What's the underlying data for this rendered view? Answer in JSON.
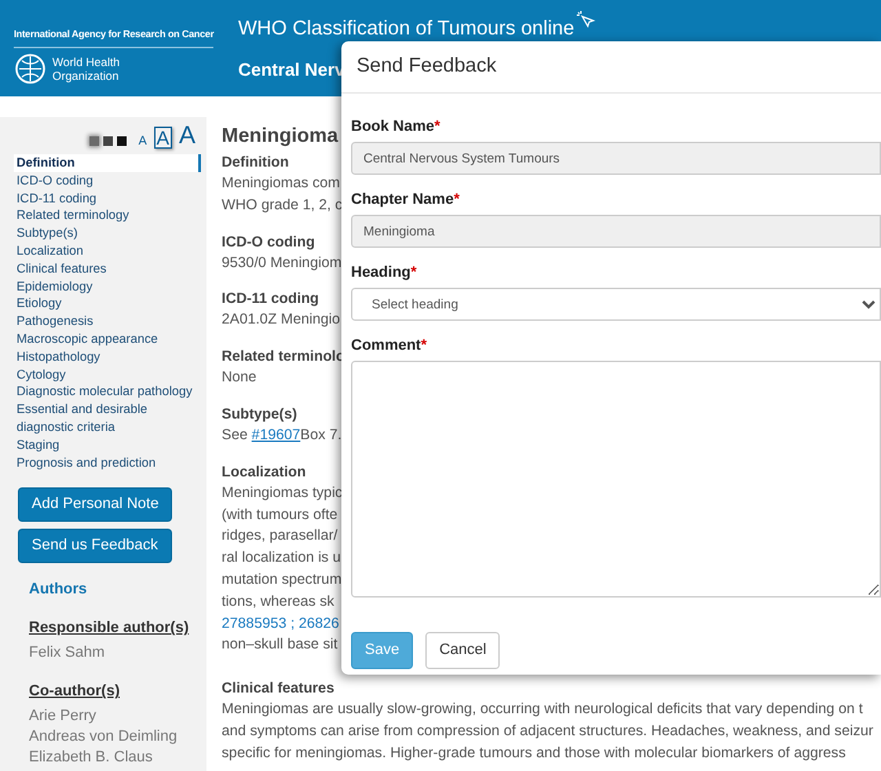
{
  "header": {
    "org_line": "International Agency for Research on Cancer",
    "who_lines": [
      "World Health",
      "Organization"
    ],
    "title": "WHO Classification of Tumours online",
    "subtitle": "Central Nerv"
  },
  "sidebar": {
    "swatches": [
      {
        "color": "#6b6b6b",
        "selected": true
      },
      {
        "color": "#444444",
        "selected": false
      },
      {
        "color": "#111111",
        "selected": false
      }
    ],
    "font_sizes": [
      {
        "label": "A",
        "selected": false
      },
      {
        "label": "A",
        "selected": true
      },
      {
        "label": "A",
        "selected": false
      }
    ],
    "nav": [
      {
        "label": "Definition",
        "selected": true
      },
      {
        "label": "ICD-O coding",
        "selected": false
      },
      {
        "label": "ICD-11 coding",
        "selected": false
      },
      {
        "label": "Related terminology",
        "selected": false
      },
      {
        "label": "Subtype(s)",
        "selected": false
      },
      {
        "label": "Localization",
        "selected": false
      },
      {
        "label": "Clinical features",
        "selected": false
      },
      {
        "label": "Epidemiology",
        "selected": false
      },
      {
        "label": "Etiology",
        "selected": false
      },
      {
        "label": "Pathogenesis",
        "selected": false
      },
      {
        "label": "Macroscopic appearance",
        "selected": false
      },
      {
        "label": "Histopathology",
        "selected": false
      },
      {
        "label": "Cytology",
        "selected": false
      },
      {
        "label": "Diagnostic molecular pathology",
        "selected": false
      },
      {
        "label": "Essential and desirable diagnostic criteria",
        "selected": false
      },
      {
        "label": "Staging",
        "selected": false
      },
      {
        "label": "Prognosis and prediction",
        "selected": false
      }
    ],
    "buttons": [
      "Add Personal Note",
      "Send us Feedback"
    ],
    "authors_title": "Authors",
    "author_groups": [
      {
        "heading": "Responsible author(s)",
        "names": [
          "Felix Sahm"
        ]
      },
      {
        "heading": "Co-author(s)",
        "names": [
          "Arie Perry",
          "Andreas von Deimling",
          "Elizabeth B. Claus"
        ]
      }
    ]
  },
  "article": {
    "title": "Meningioma",
    "sections": [
      {
        "heading": "Definition",
        "lines": [
          [
            {
              "kind": "text",
              "text": "Meningiomas com"
            }
          ],
          [
            {
              "kind": "text",
              "text": "WHO grade 1, 2, c"
            }
          ]
        ]
      },
      {
        "heading": "ICD-O coding",
        "lines": [
          [
            {
              "kind": "text",
              "text": "9530/0 Meningiom"
            }
          ]
        ]
      },
      {
        "heading": "ICD-11 coding",
        "lines": [
          [
            {
              "kind": "text",
              "text": "2A01.0Z Meningio"
            }
          ]
        ]
      },
      {
        "heading": "Related terminolo",
        "lines": [
          [
            {
              "kind": "text",
              "text": "None"
            }
          ]
        ]
      },
      {
        "heading": "Subtype(s)",
        "lines": [
          [
            {
              "kind": "text",
              "text": "See "
            },
            {
              "kind": "link",
              "text": "#19607"
            },
            {
              "kind": "text",
              "text": "Box 7."
            }
          ]
        ]
      },
      {
        "heading": "Localization",
        "lines": [
          [
            {
              "kind": "text",
              "text": "Meningiomas typic"
            }
          ],
          [
            {
              "kind": "text",
              "text": "(with tumours ofte"
            }
          ],
          [
            {
              "kind": "text",
              "text": "ridges, parasellar/"
            }
          ],
          [
            {
              "kind": "text",
              "text": "ral localization is u"
            }
          ],
          [
            {
              "kind": "text",
              "text": "mutation spectrum"
            }
          ],
          [
            {
              "kind": "text",
              "text": "tions, whereas sk"
            }
          ],
          [
            {
              "kind": "link",
              "text": "27885953 ; 26826"
            }
          ],
          [
            {
              "kind": "text",
              "text": "non–skull base sit"
            }
          ]
        ]
      },
      {
        "heading": "Clinical features",
        "lines": [
          [
            {
              "kind": "text",
              "text": "Meningiomas are usually slow-growing, occurring with neurological deficits that vary depending on t"
            }
          ],
          [
            {
              "kind": "text",
              "text": "and symptoms can arise from compression of adjacent structures. Headaches, weakness, and seizur"
            }
          ],
          [
            {
              "kind": "text",
              "text": "specific for meningiomas. Higher-grade tumours and those with molecular biomarkers of aggress"
            }
          ]
        ]
      }
    ]
  },
  "modal": {
    "title": "Send Feedback",
    "fields": [
      {
        "kind": "readonly",
        "label": "Book Name",
        "required": true,
        "required_mark": "*",
        "value": "Central Nervous System Tumours"
      },
      {
        "kind": "readonly",
        "label": "Chapter Name",
        "required": true,
        "required_mark": "*",
        "value": "Meningioma"
      },
      {
        "kind": "select",
        "label": "Heading",
        "required": true,
        "required_mark": "*",
        "placeholder": "Select heading"
      },
      {
        "kind": "textarea",
        "label": "Comment",
        "required": true,
        "required_mark": "*"
      }
    ],
    "buttons": [
      {
        "label": "Save",
        "kind": "primary"
      },
      {
        "label": "Cancel",
        "kind": "secondary"
      }
    ]
  }
}
